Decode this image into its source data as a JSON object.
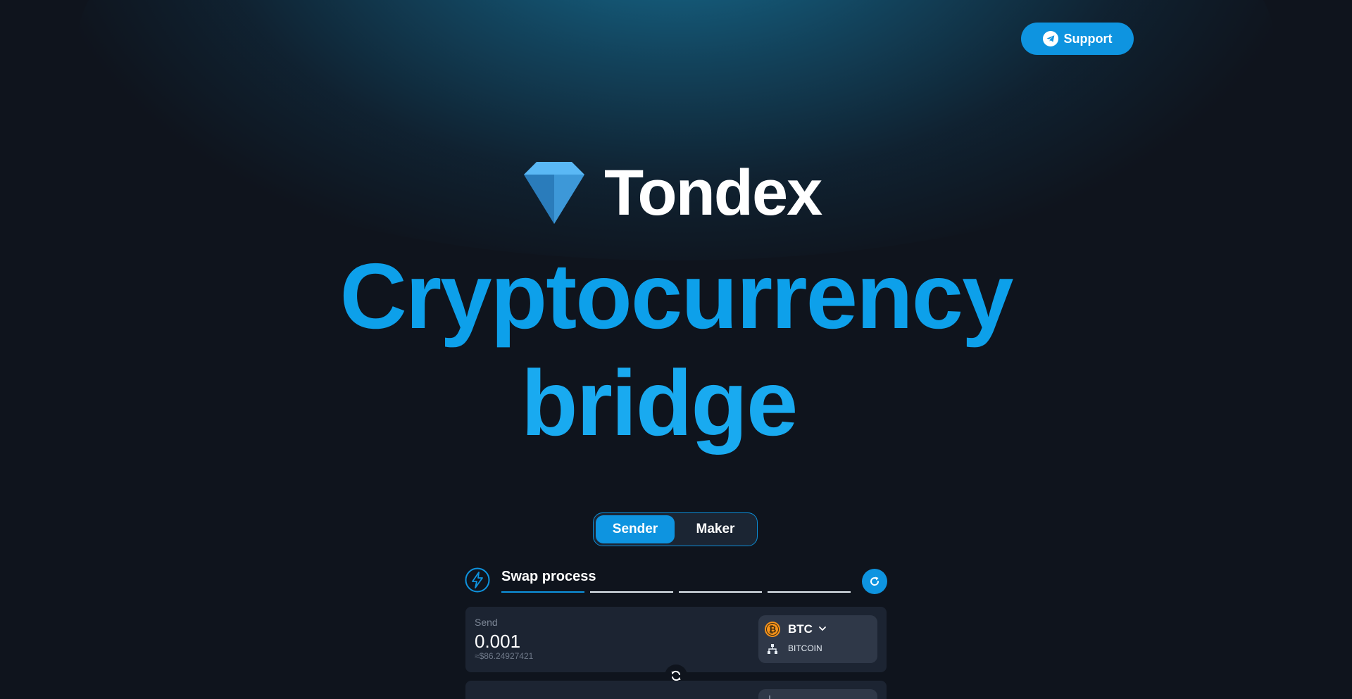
{
  "header": {
    "support_label": "Support"
  },
  "brand": {
    "name": "Tondex"
  },
  "hero": {
    "line1": "Cryptocurrency",
    "line2": "bridge"
  },
  "mode_toggle": {
    "options": [
      "Sender",
      "Maker"
    ],
    "selected": "Sender"
  },
  "swap": {
    "title": "Swap process",
    "steps_total": 4,
    "current_step": 1,
    "send": {
      "label": "Send",
      "amount": "0.001",
      "usd_value": "≈$86.24927421",
      "token": "BTC",
      "network": "BITCOIN"
    }
  },
  "colors": {
    "accent": "#0e94e0",
    "hero_text": "#0da0ea",
    "background": "#0f141d",
    "card": "#1c2432",
    "token_pill": "#2f3848",
    "bitcoin": "#f7931a"
  },
  "icons": {
    "support": "telegram-icon",
    "brand": "diamond-logo",
    "process": "lightning-icon",
    "refresh": "refresh-icon",
    "swap_direction": "swap-arrows-icon",
    "token": "bitcoin-icon",
    "dropdown": "chevron-down-icon",
    "network": "network-tree-icon"
  }
}
